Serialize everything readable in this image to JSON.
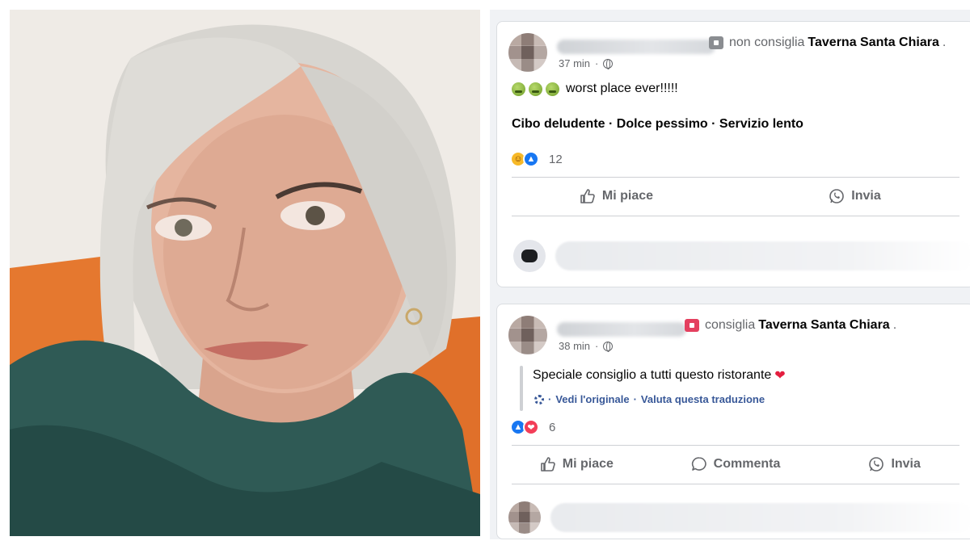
{
  "posts": [
    {
      "verb": "non consiglia",
      "page": "Taverna Santa Chiara",
      "time": "37 min",
      "text": "worst place ever!!!!!",
      "tags": "Cibo deludente · Dolce pessimo · Servizio lento",
      "reaction_count": "12",
      "reactions": [
        "haha",
        "like"
      ],
      "actions": {
        "like": "Mi piace",
        "send": "Invia"
      }
    },
    {
      "verb": "consiglia",
      "page": "Taverna Santa Chiara",
      "time": "38 min",
      "text": "Speciale consiglio a tutti questo ristorante",
      "see_original": "Vedi l'originale",
      "rate_translation": "Valuta questa traduzione",
      "reaction_count": "6",
      "reactions": [
        "like",
        "love"
      ],
      "actions": {
        "like": "Mi piace",
        "comment": "Commenta",
        "send": "Invia"
      }
    }
  ],
  "icons": {
    "recommend_negative": "not-recommend-icon",
    "recommend_positive": "recommend-icon",
    "privacy": "globe-icon",
    "emoji": "nauseated-face-icon",
    "heart": "red-heart-icon"
  },
  "colors": {
    "link": "#385898",
    "like": "#1877f2",
    "love": "#f33e58",
    "recommend": "#e4405f"
  }
}
